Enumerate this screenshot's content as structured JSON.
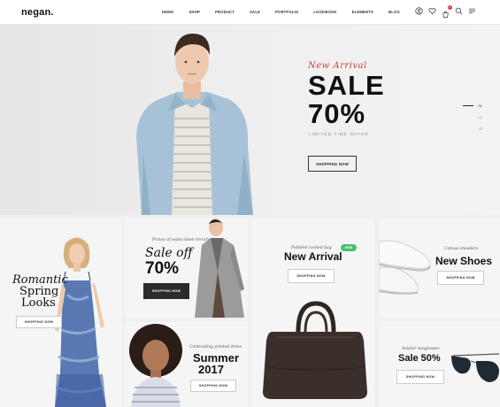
{
  "header": {
    "logo": "negan.",
    "nav": [
      "DEMO",
      "SHOP",
      "PRODUCT",
      "SALE",
      "PORTFOLIO",
      "LOOKBOOK",
      "ELEMENTS",
      "BLOG"
    ],
    "icons": [
      "user-icon",
      "heart-icon",
      "cart-icon",
      "search-icon",
      "menu-icon"
    ],
    "cart_count": "0"
  },
  "hero": {
    "script": "New Arrival",
    "title": "SALE",
    "percent": "70%",
    "subtitle": "LIMITED TIME OFFER",
    "button": "SHOPPING NOW",
    "slides": [
      "01",
      "02",
      "03"
    ],
    "active_slide": "01"
  },
  "tiles": {
    "romantic": {
      "title_1": "Romantic",
      "title_2": "Spring",
      "title_3": "Looks",
      "button": "SHOPPING NOW"
    },
    "saleoff": {
      "script": "Prince of wales linen trench",
      "title_1": "Sale off",
      "title_2": "70%",
      "button": "SHOPPING NOW"
    },
    "summer": {
      "script": "Contrasting printed dress",
      "title_1": "Summer",
      "title_2": "2017",
      "button": "SHOPPING NOW"
    },
    "newarrival": {
      "script": "Pebbled cocked bag",
      "badge": "NEW",
      "title": "New Arrival",
      "button": "SHOPPING NOW"
    },
    "newshoes": {
      "script": "Canvas sneakers",
      "title": "New Shoes",
      "button": "SHOPPING NOW"
    },
    "aviator": {
      "script": "Aviator sunglasses",
      "title": "Sale 50%",
      "button": "SHOPPING NOW"
    }
  },
  "colors": {
    "accent_red": "#d63a3a",
    "badge_green": "#45c26a",
    "dark_button": "#2b2b2b"
  }
}
